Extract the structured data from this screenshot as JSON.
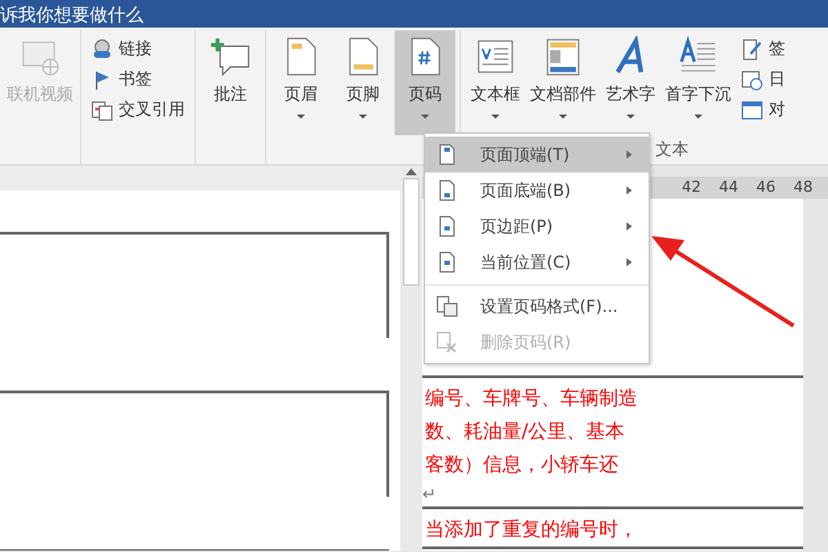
{
  "title_bar": {
    "text": "诉我你想要做什么"
  },
  "ribbon": {
    "groups": [
      {
        "kind": "large",
        "items": [
          {
            "label": "联机视频",
            "disabled": true,
            "dropdown": false,
            "selected": false
          }
        ]
      },
      {
        "kind": "small",
        "items": [
          {
            "label": "链接"
          },
          {
            "label": "书签"
          },
          {
            "label": "交叉引用"
          }
        ]
      },
      {
        "kind": "large",
        "items": [
          {
            "label": "批注",
            "disabled": false,
            "dropdown": false,
            "selected": false
          }
        ]
      },
      {
        "kind": "large",
        "items": [
          {
            "label": "页眉",
            "disabled": false,
            "dropdown": true,
            "selected": false
          },
          {
            "label": "页脚",
            "disabled": false,
            "dropdown": true,
            "selected": false
          },
          {
            "label": "页码",
            "disabled": false,
            "dropdown": true,
            "selected": true
          }
        ]
      },
      {
        "kind": "large",
        "label": "文本",
        "items": [
          {
            "label": "文本框",
            "disabled": false,
            "dropdown": true,
            "selected": false
          },
          {
            "label": "文档部件",
            "disabled": false,
            "dropdown": true,
            "selected": false
          },
          {
            "label": "艺术字",
            "disabled": false,
            "dropdown": true,
            "selected": false
          },
          {
            "label": "首字下沉",
            "disabled": false,
            "dropdown": true,
            "selected": false
          }
        ],
        "side_items": [
          {
            "label": "签"
          },
          {
            "label": "日"
          },
          {
            "label": "对"
          }
        ]
      }
    ]
  },
  "ruler": {
    "ticks": [
      "42",
      "44",
      "46",
      "48"
    ]
  },
  "menu": {
    "items": [
      {
        "label": "页面顶端(T)",
        "submenu": true,
        "selected": true,
        "disabled": false,
        "divider_before": false
      },
      {
        "label": "页面底端(B)",
        "submenu": true,
        "selected": false,
        "disabled": false,
        "divider_before": false
      },
      {
        "label": "页边距(P)",
        "submenu": true,
        "selected": false,
        "disabled": false,
        "divider_before": false
      },
      {
        "label": "当前位置(C)",
        "submenu": true,
        "selected": false,
        "disabled": false,
        "divider_before": false
      },
      {
        "label": "设置页码格式(F)...",
        "submenu": false,
        "selected": false,
        "disabled": false,
        "divider_before": true
      },
      {
        "label": "删除页码(R)",
        "submenu": false,
        "selected": false,
        "disabled": true,
        "divider_before": false
      }
    ]
  },
  "document": {
    "cells": [
      {
        "lines": [
          "编号、车牌号、车辆制造",
          "数、耗油量/公里、基本",
          "客数）信息，小轿车还"
        ],
        "paragraph_mark": "↵"
      },
      {
        "lines": [
          "当添加了重复的编号时，"
        ]
      }
    ]
  }
}
